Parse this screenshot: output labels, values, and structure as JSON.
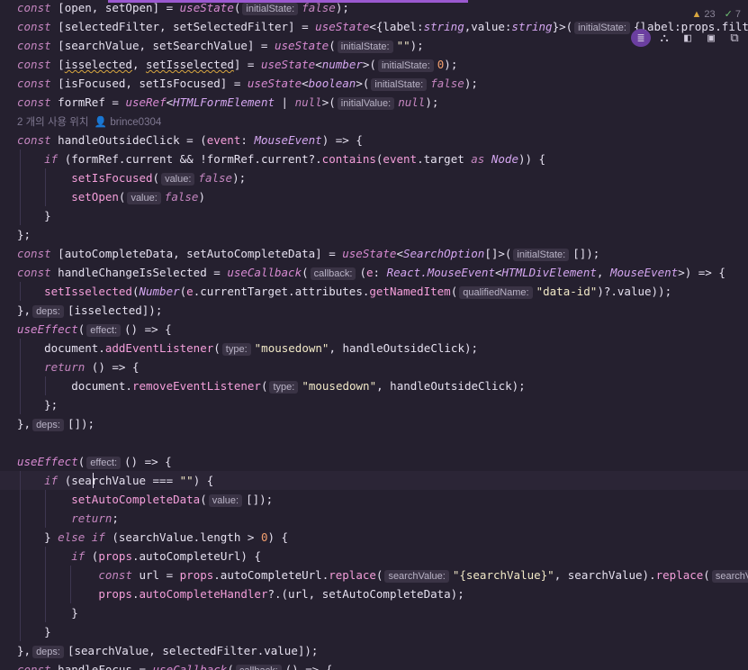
{
  "status": {
    "warnings": "23",
    "checks": "7"
  },
  "toolbar": {
    "icons": [
      "outline-icon",
      "split-icon",
      "layout-icon",
      "image-icon",
      "copy-icon"
    ]
  },
  "codelens": "2 개의 사용 위치  👤 brince0304",
  "lines": [
    "const [open, setOpen] = useState( initialState: false);",
    "const [selectedFilter, setSelectedFilter] = useState<{label:string,value:string}>( initialState: {label:props.filterOptio",
    "const [searchValue, setSearchValue] = useState( initialState: \"\");",
    "const [isselected, setIsselected] = useState<number>( initialState: 0);",
    "const [isFocused, setIsFocused] = useState<boolean>( initialState: false);",
    "const formRef = useRef<HTMLFormElement | null>( initialValue: null);"
  ]
}
